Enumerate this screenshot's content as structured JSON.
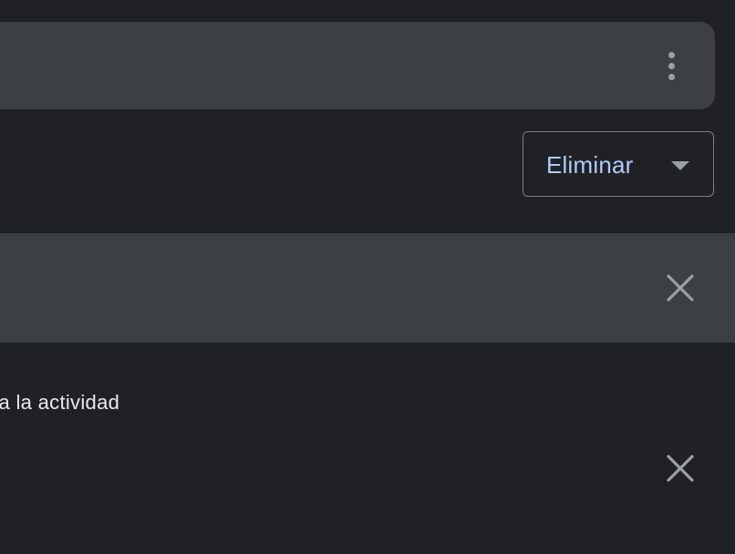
{
  "toolbar": {
    "more_icon": "more-vert-icon",
    "delete_dropdown": {
      "label": "Eliminar",
      "icon": "arrow-drop-down-icon"
    }
  },
  "banner": {
    "close_icon": "close-icon"
  },
  "activity_item": {
    "text": "da la actividad",
    "close_icon": "close-icon"
  },
  "colors": {
    "background": "#202124",
    "surface": "#3c4043",
    "accent_text": "#aecbfa",
    "icon": "#9aa0a6",
    "primary_text": "#e8eaed"
  }
}
